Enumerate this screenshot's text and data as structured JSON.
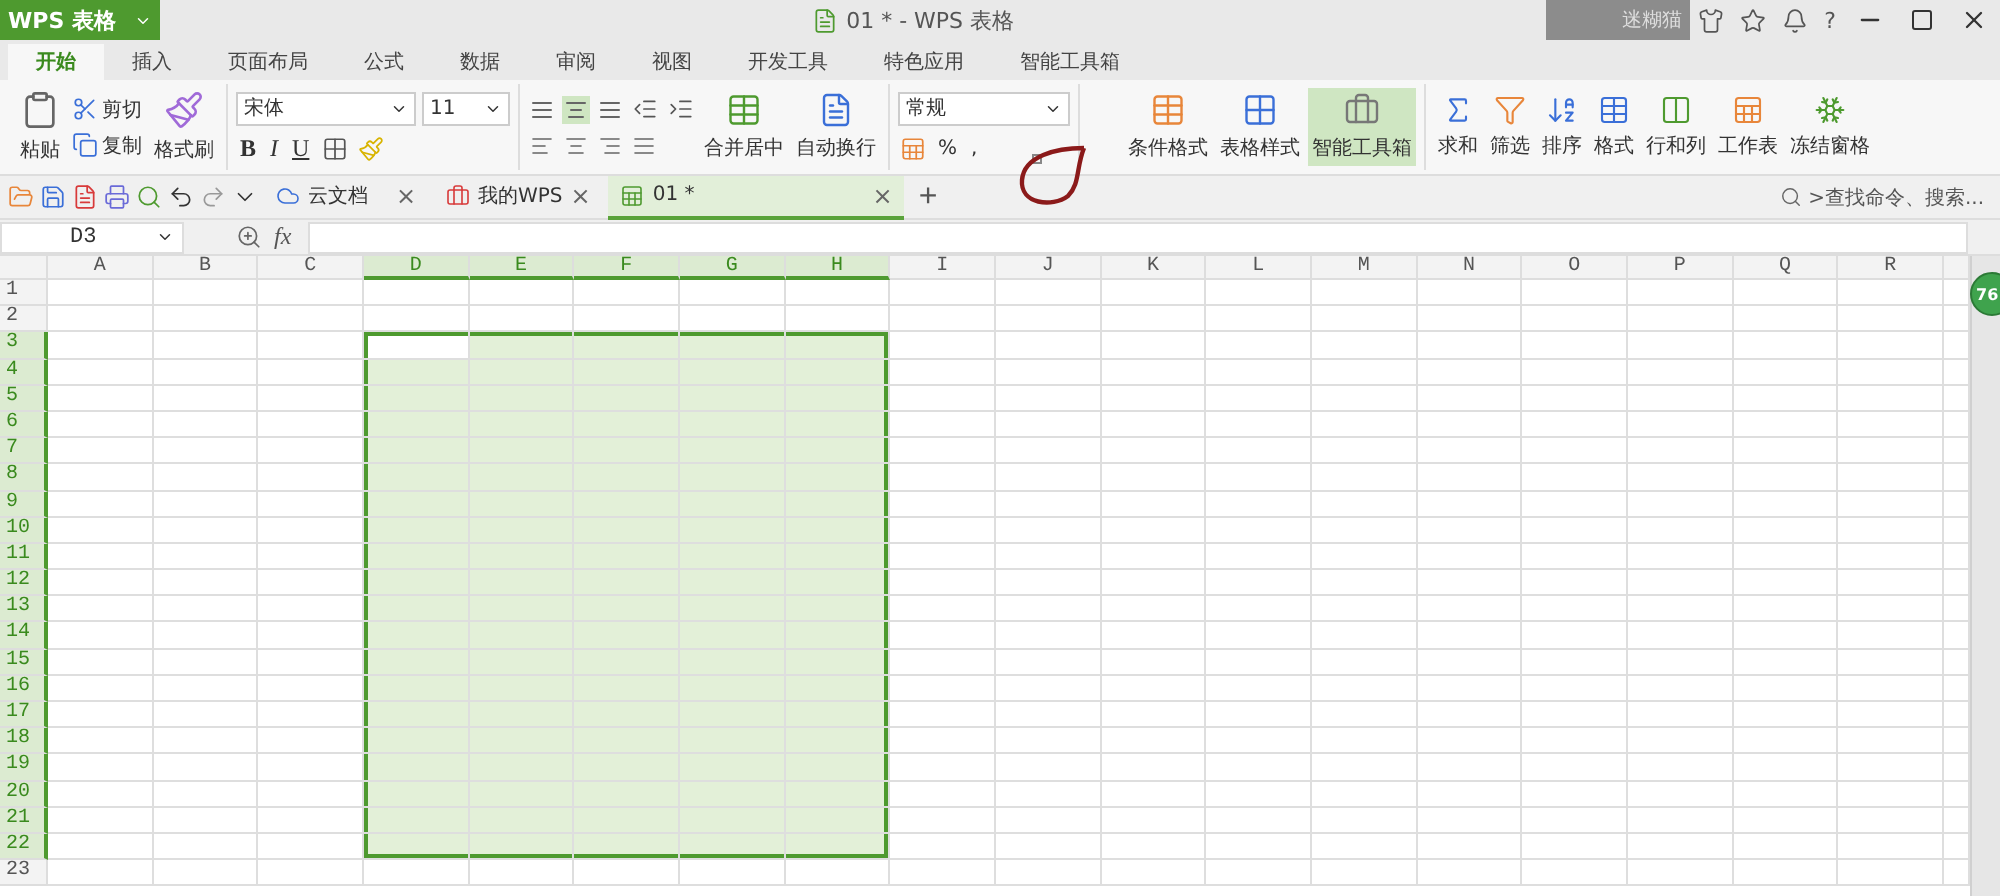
{
  "title_bar": {
    "app_button": "WPS 表格",
    "document_title": "01 * - WPS 表格",
    "account": "迷糊猫",
    "help": "?"
  },
  "menu_tabs": [
    {
      "label": "开始",
      "selected": true
    },
    {
      "label": "插入",
      "selected": false
    },
    {
      "label": "页面布局",
      "selected": false
    },
    {
      "label": "公式",
      "selected": false
    },
    {
      "label": "数据",
      "selected": false
    },
    {
      "label": "审阅",
      "selected": false
    },
    {
      "label": "视图",
      "selected": false
    },
    {
      "label": "开发工具",
      "selected": false
    },
    {
      "label": "特色应用",
      "selected": false
    },
    {
      "label": "智能工具箱",
      "selected": false
    }
  ],
  "ribbon": {
    "paste": "粘贴",
    "cut": "剪切",
    "copy": "复制",
    "format_painter": "格式刷",
    "font_name": "宋体",
    "font_size": "11",
    "bold": "B",
    "italic": "I",
    "underline": "U",
    "vertical_align": [
      {
        "selected": false
      },
      {
        "selected": true
      },
      {
        "selected": false
      }
    ],
    "merge_center": "合并居中",
    "wrap_text": "自动换行",
    "number_format": "常规",
    "percent": "%",
    "comma": ",",
    "style_buttons": [
      {
        "label": "条件格式",
        "selected": false
      },
      {
        "label": "表格样式",
        "selected": false
      },
      {
        "label": "智能工具箱",
        "selected": true
      }
    ],
    "tools": [
      {
        "label": "求和"
      },
      {
        "label": "筛选"
      },
      {
        "label": "排序"
      },
      {
        "label": "格式"
      },
      {
        "label": "行和列"
      },
      {
        "label": "工作表"
      },
      {
        "label": "冻结窗格"
      }
    ]
  },
  "doc_tabs": [
    {
      "label": "云文档",
      "selected": false,
      "close": "×"
    },
    {
      "label": "我的WPS",
      "selected": false,
      "close": "×"
    },
    {
      "label": "01 *",
      "selected": true,
      "close": "×"
    }
  ],
  "new_tab": "+",
  "command_search": {
    "placeholder": ">查找命令、搜索..."
  },
  "formula_bar": {
    "name_box": "D3",
    "fx": "fx"
  },
  "columns": [
    {
      "label": "A",
      "selected": false
    },
    {
      "label": "B",
      "selected": false
    },
    {
      "label": "C",
      "selected": false
    },
    {
      "label": "D",
      "selected": true
    },
    {
      "label": "E",
      "selected": true
    },
    {
      "label": "F",
      "selected": true
    },
    {
      "label": "G",
      "selected": true
    },
    {
      "label": "H",
      "selected": true
    },
    {
      "label": "I",
      "selected": false
    },
    {
      "label": "J",
      "selected": false
    },
    {
      "label": "K",
      "selected": false
    },
    {
      "label": "L",
      "selected": false
    },
    {
      "label": "M",
      "selected": false
    },
    {
      "label": "N",
      "selected": false
    },
    {
      "label": "O",
      "selected": false
    },
    {
      "label": "P",
      "selected": false
    },
    {
      "label": "Q",
      "selected": false
    },
    {
      "label": "R",
      "selected": false
    }
  ],
  "rows": [
    {
      "label": "1",
      "selected": false
    },
    {
      "label": "2",
      "selected": false
    },
    {
      "label": "3",
      "selected": true
    },
    {
      "label": "4",
      "selected": true
    },
    {
      "label": "5",
      "selected": true
    },
    {
      "label": "6",
      "selected": true
    },
    {
      "label": "7",
      "selected": true
    },
    {
      "label": "8",
      "selected": true
    },
    {
      "label": "9",
      "selected": true
    },
    {
      "label": "10",
      "selected": true
    },
    {
      "label": "11",
      "selected": true
    },
    {
      "label": "12",
      "selected": true
    },
    {
      "label": "13",
      "selected": true
    },
    {
      "label": "14",
      "selected": true
    },
    {
      "label": "15",
      "selected": true
    },
    {
      "label": "16",
      "selected": true
    },
    {
      "label": "17",
      "selected": true
    },
    {
      "label": "18",
      "selected": true
    },
    {
      "label": "19",
      "selected": true
    },
    {
      "label": "20",
      "selected": true
    },
    {
      "label": "21",
      "selected": true
    },
    {
      "label": "22",
      "selected": true
    },
    {
      "label": "23",
      "selected": false
    }
  ],
  "float_badge": "76"
}
